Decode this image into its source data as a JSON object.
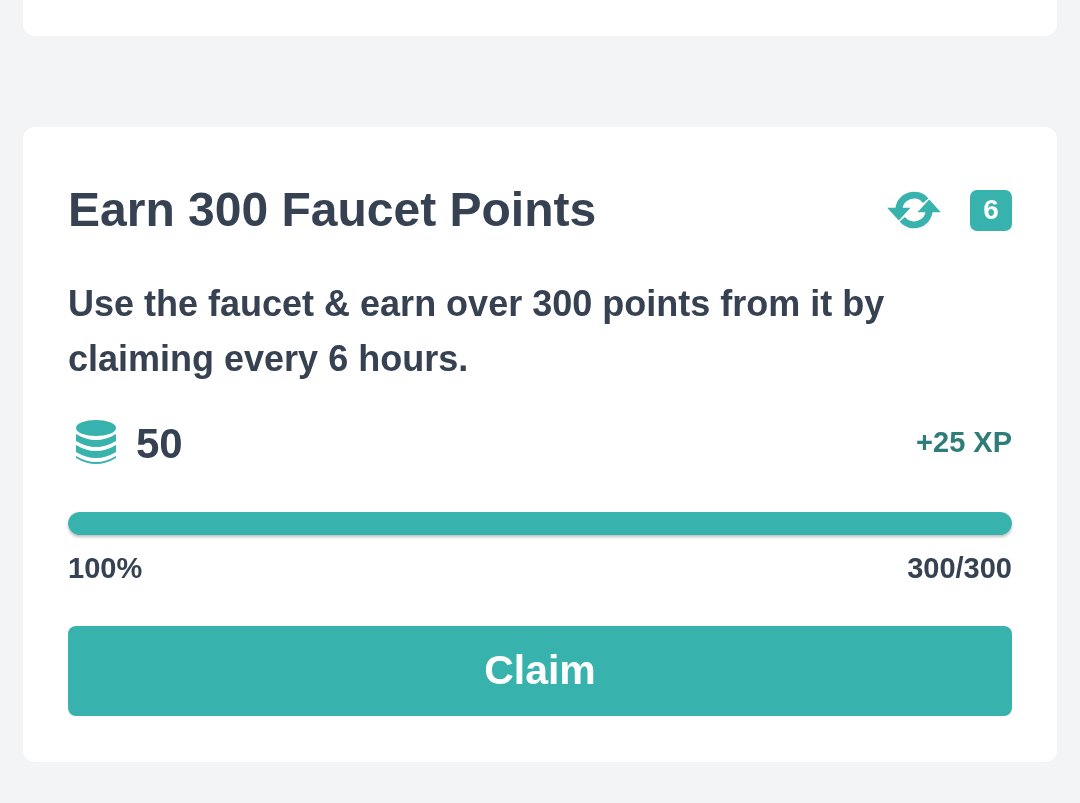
{
  "task_card": {
    "title": "Earn 300 Faucet Points",
    "repeat_count": "6",
    "description": "Use the faucet & earn over 300 points from it by claiming every 6 hours.",
    "reward_points": "50",
    "reward_xp": "+25 XP",
    "progress": {
      "level": 1,
      "percent": "100%",
      "count": "300/300"
    },
    "button": "Claim"
  }
}
